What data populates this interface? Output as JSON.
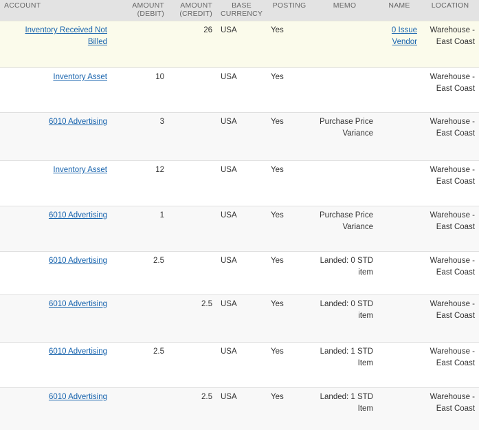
{
  "table": {
    "columns": [
      {
        "key": "account",
        "label": "ACCOUNT"
      },
      {
        "key": "debit",
        "label": "AMOUNT (DEBIT)",
        "line1": "AMOUNT",
        "line2": "(DEBIT)"
      },
      {
        "key": "credit",
        "label": "AMOUNT (CREDIT)",
        "line1": "AMOUNT",
        "line2": "(CREDIT)"
      },
      {
        "key": "currency",
        "label": "BASE CURRENCY",
        "line1": "BASE",
        "line2": "CURRENCY"
      },
      {
        "key": "posting",
        "label": "POSTING"
      },
      {
        "key": "memo",
        "label": "MEMO"
      },
      {
        "key": "name",
        "label": "NAME"
      },
      {
        "key": "location",
        "label": "LOCATION"
      }
    ],
    "rows": [
      {
        "account": "Inventory Received Not Billed",
        "account_is_link": true,
        "debit": "",
        "credit": "26",
        "currency": "USA",
        "posting": "Yes",
        "memo": "",
        "name": "0 Issue Vendor",
        "name_is_link": true,
        "location": "Warehouse - East Coast",
        "style": "row-highlight"
      },
      {
        "account": "Inventory Asset",
        "account_is_link": true,
        "debit": "10",
        "credit": "",
        "currency": "USA",
        "posting": "Yes",
        "memo": "",
        "name": "",
        "name_is_link": false,
        "location": "Warehouse - East Coast",
        "style": "row-white"
      },
      {
        "account": "6010 Advertising",
        "account_is_link": true,
        "debit": "3",
        "credit": "",
        "currency": "USA",
        "posting": "Yes",
        "memo": "Purchase Price Variance",
        "name": "",
        "name_is_link": false,
        "location": "Warehouse - East Coast",
        "style": "row-alt"
      },
      {
        "account": "Inventory Asset",
        "account_is_link": true,
        "debit": "12",
        "credit": "",
        "currency": "USA",
        "posting": "Yes",
        "memo": "",
        "name": "",
        "name_is_link": false,
        "location": "Warehouse - East Coast",
        "style": "row-white"
      },
      {
        "account": "6010 Advertising",
        "account_is_link": true,
        "debit": "1",
        "credit": "",
        "currency": "USA",
        "posting": "Yes",
        "memo": "Purchase Price Variance",
        "name": "",
        "name_is_link": false,
        "location": "Warehouse - East Coast",
        "style": "row-alt"
      },
      {
        "account": "6010 Advertising",
        "account_is_link": true,
        "debit": "2.5",
        "credit": "",
        "currency": "USA",
        "posting": "Yes",
        "memo": "Landed: 0 STD item",
        "name": "",
        "name_is_link": false,
        "location": "Warehouse - East Coast",
        "style": "row-white"
      },
      {
        "account": "6010 Advertising",
        "account_is_link": true,
        "debit": "",
        "credit": "2.5",
        "currency": "USA",
        "posting": "Yes",
        "memo": "Landed: 0 STD item",
        "name": "",
        "name_is_link": false,
        "location": "Warehouse - East Coast",
        "style": "row-alt"
      },
      {
        "account": "6010 Advertising",
        "account_is_link": true,
        "debit": "2.5",
        "credit": "",
        "currency": "USA",
        "posting": "Yes",
        "memo": "Landed: 1 STD Item",
        "name": "",
        "name_is_link": false,
        "location": "Warehouse - East Coast",
        "style": "row-white"
      },
      {
        "account": "6010 Advertising",
        "account_is_link": true,
        "debit": "",
        "credit": "2.5",
        "currency": "USA",
        "posting": "Yes",
        "memo": "Landed: 1 STD Item",
        "name": "",
        "name_is_link": false,
        "location": "Warehouse - East Coast",
        "style": "row-alt"
      }
    ]
  },
  "colors": {
    "header_bg": "#e3e3e3",
    "header_text": "#666666",
    "link": "#1763ad",
    "row_highlight_bg": "#fbfbeb",
    "row_alt_bg": "#f8f8f8",
    "row_border": "#e0e0e0",
    "body_text": "#333333"
  }
}
